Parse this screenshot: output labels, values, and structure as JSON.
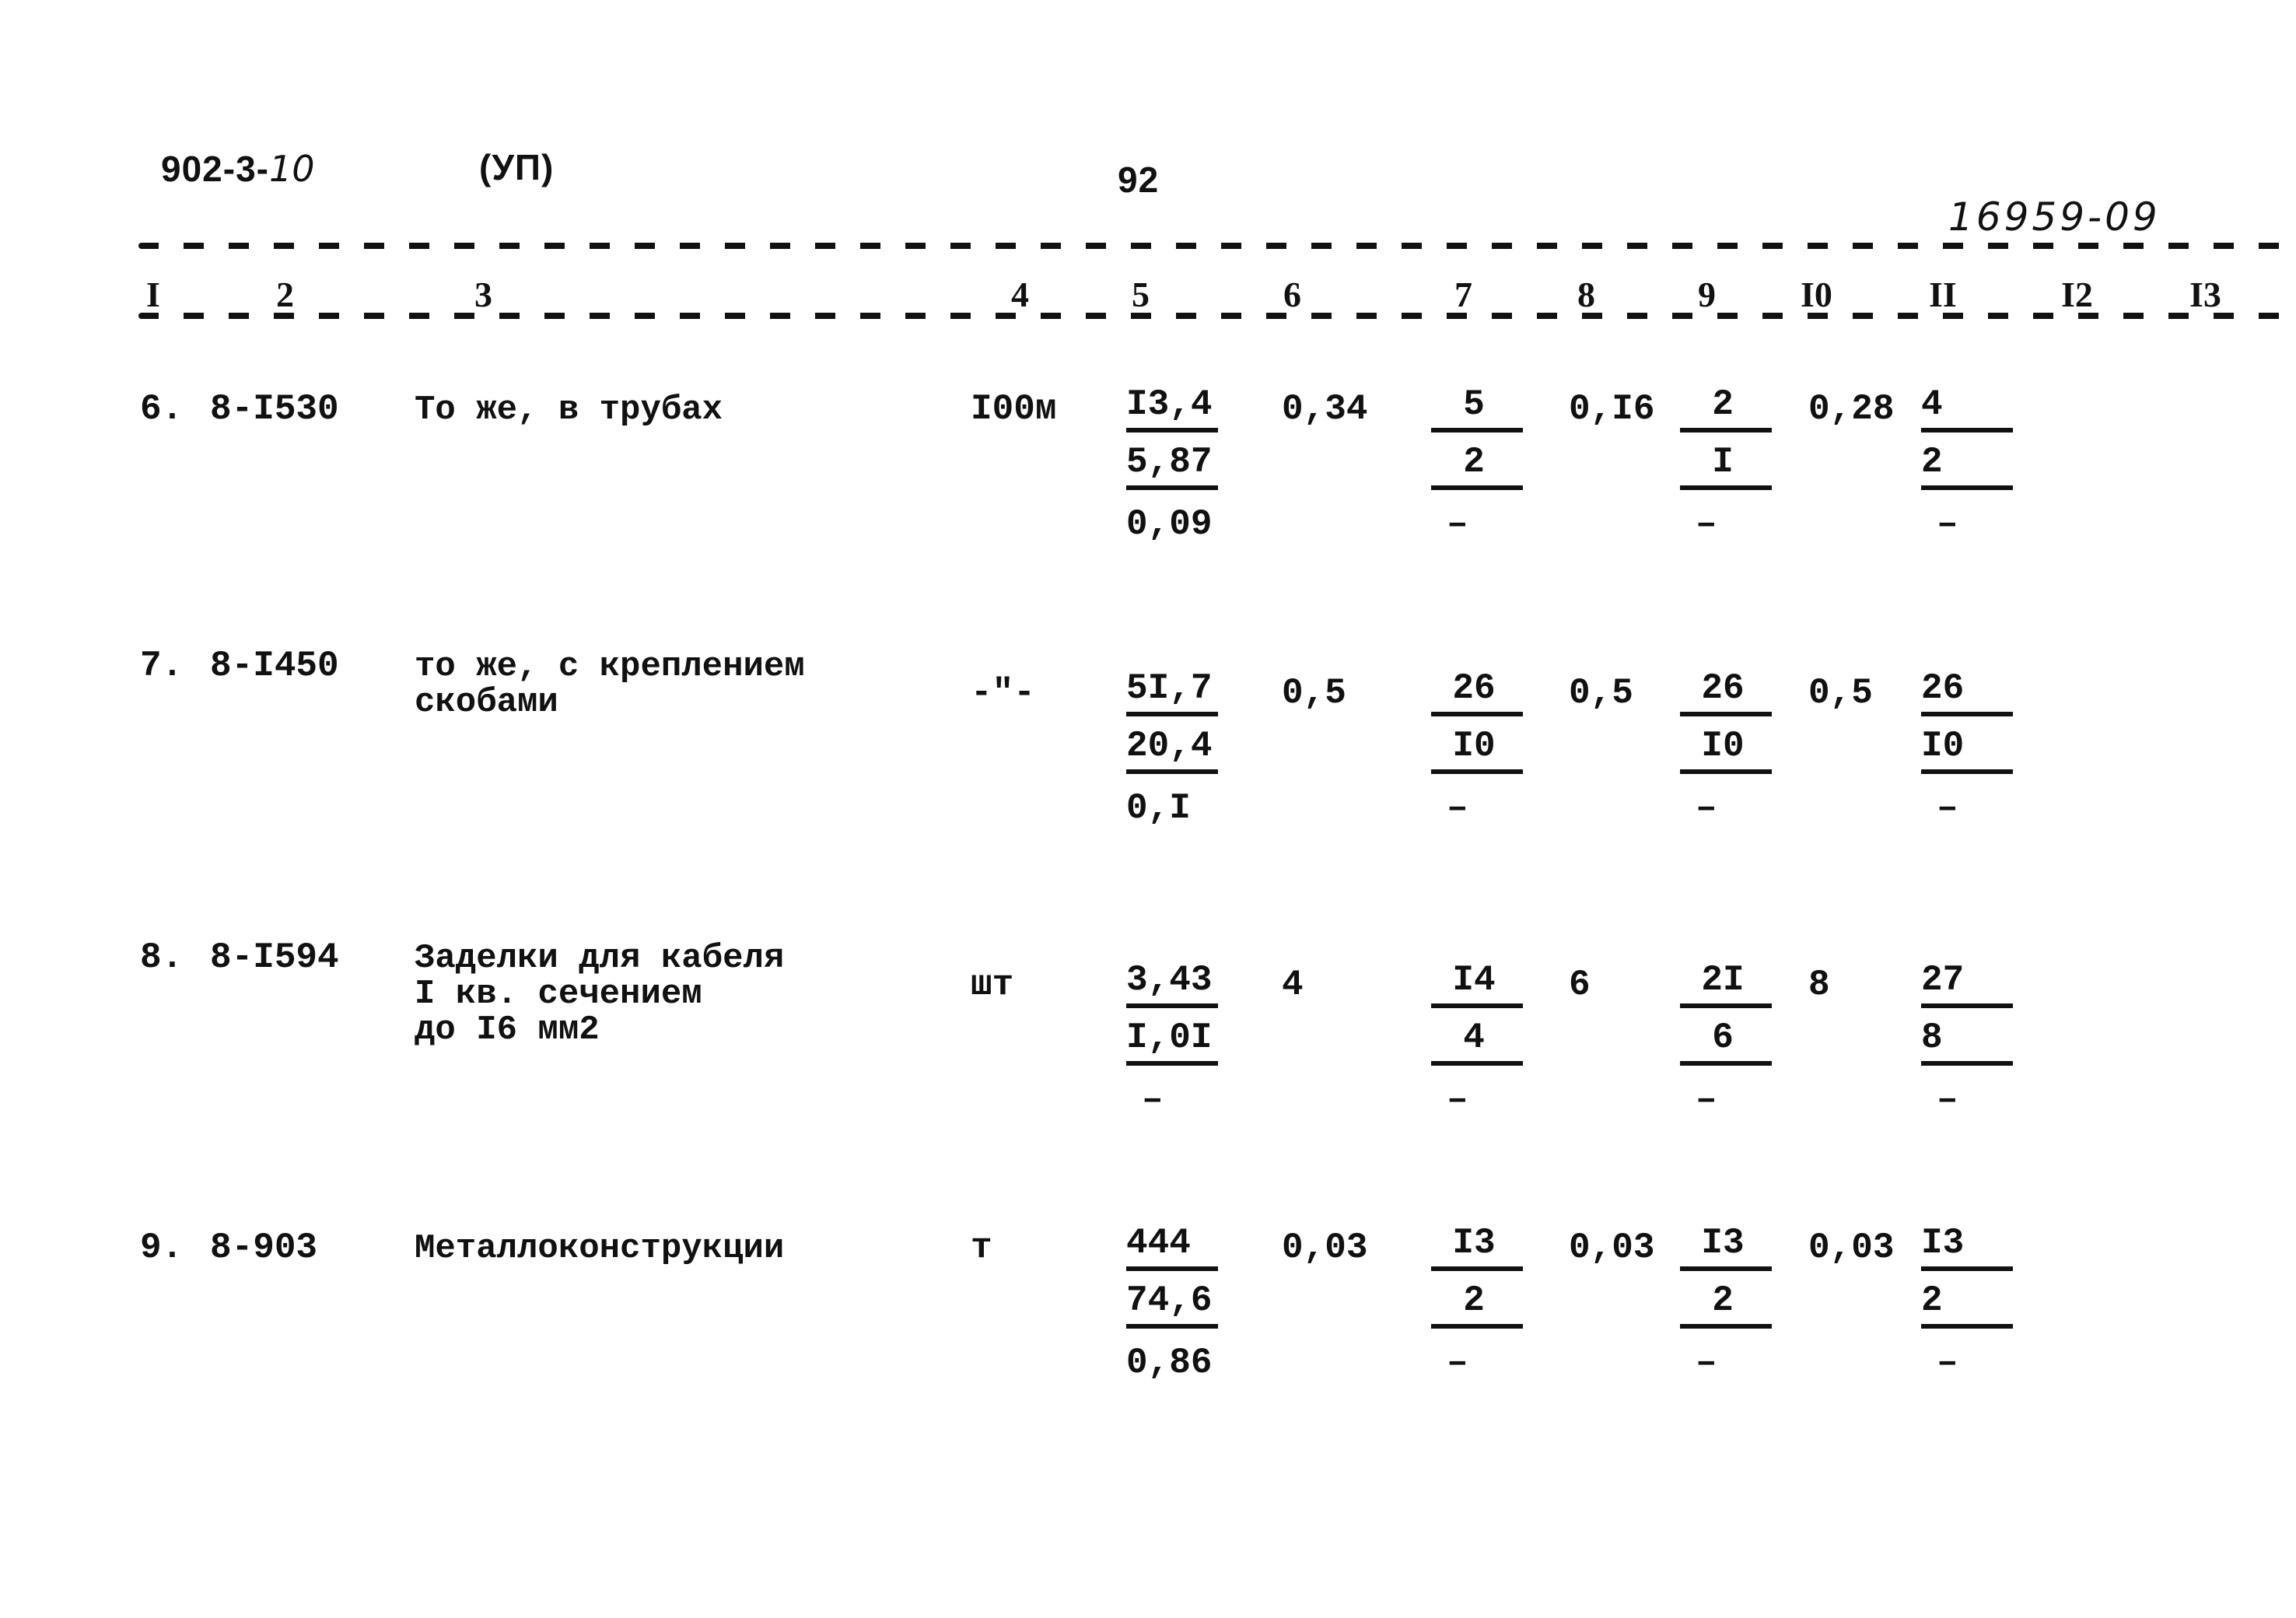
{
  "header": {
    "doc_code_prefix": "902-3-",
    "doc_code_suffix": "10",
    "section": "(УП)",
    "page_number": "92",
    "inventory_number": "16959-09"
  },
  "column_numbers": [
    "I",
    "2",
    "3",
    "4",
    "5",
    "6",
    "7",
    "8",
    "9",
    "I0",
    "II",
    "I2",
    "I3"
  ],
  "rows": [
    {
      "num": "6.",
      "code": "8-I530",
      "description": [
        "То же, в трубах"
      ],
      "unit": "I00м",
      "c5": [
        "I3,4",
        "5,87",
        "0,09"
      ],
      "c6": "0,34",
      "c7": [
        "5",
        "2",
        "-"
      ],
      "c8": "0,I6",
      "c9": [
        "2",
        "I",
        "-"
      ],
      "c10": "0,28",
      "c11": [
        "4",
        "2",
        "-"
      ]
    },
    {
      "num": "7.",
      "code": "8-I450",
      "description": [
        "то же, с креплением",
        "скобами"
      ],
      "unit": "-\"-",
      "c5": [
        "5I,7",
        "20,4",
        "0,I"
      ],
      "c6": "0,5",
      "c7": [
        "26",
        "I0",
        "-"
      ],
      "c8": "0,5",
      "c9": [
        "26",
        "I0",
        "-"
      ],
      "c10": "0,5",
      "c11": [
        "26",
        "I0",
        "-"
      ]
    },
    {
      "num": "8.",
      "code": "8-I594",
      "description": [
        "Заделки для кабеля",
        "I кв. сечением",
        "до I6 мм2"
      ],
      "unit": "шт",
      "c5": [
        "3,43",
        "I,0I",
        "-"
      ],
      "c6": "4",
      "c7": [
        "I4",
        "4",
        "-"
      ],
      "c8": "6",
      "c9": [
        "2I",
        "6",
        "-"
      ],
      "c10": "8",
      "c11": [
        "27",
        "8",
        "-"
      ]
    },
    {
      "num": "9.",
      "code": "8-903",
      "description": [
        "Металлоконструкции"
      ],
      "unit": "т",
      "c5": [
        "444",
        "74,6",
        "0,86"
      ],
      "c6": "0,03",
      "c7": [
        "I3",
        "2",
        "-"
      ],
      "c8": "0,03",
      "c9": [
        "I3",
        "2",
        "-"
      ],
      "c10": "0,03",
      "c11": [
        "I3",
        "2",
        "-"
      ]
    }
  ]
}
